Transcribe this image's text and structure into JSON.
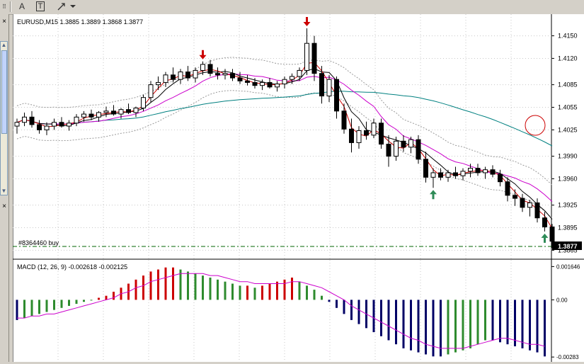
{
  "toolbar": {
    "buttons": [
      {
        "name": "text-tool-button",
        "label": "A"
      },
      {
        "name": "text-label-tool-button",
        "label": "T"
      },
      {
        "name": "arrows-tool-button",
        "label": "arrows-icon"
      }
    ]
  },
  "chart": {
    "symbol_line": "EURUSD,M15  1.3885 1.3889 1.3868 1.3877",
    "order_label": "#8364460 buy",
    "current_price": "1.3877",
    "price_ticks": [
      "1.4150",
      "1.4120",
      "1.4085",
      "1.4055",
      "1.4025",
      "1.3990",
      "1.3960",
      "1.3925",
      "1.3895",
      "1.3865"
    ],
    "macd_label": "MACD (12, 26, 9)  -0.002618 -0.002125",
    "macd_ticks": [
      "0.001646",
      "0.00",
      "-0.00283"
    ],
    "colors": {
      "bull": "#ffffff",
      "bear": "#000000",
      "ma_fast": "#cc0000",
      "ma_mid": "#000000",
      "ma_slow": "#cc00cc",
      "ma_long": "#008080",
      "envelope": "#999999",
      "hist_up": "#cc0000",
      "hist_green": "#2e8b2e",
      "hist_navy": "#000066",
      "signal": "#cc00cc",
      "order_line": "#006600"
    }
  },
  "chart_data": {
    "type": "candlestick",
    "ylim": [
      1.3855,
      1.4175
    ],
    "candles": [
      [
        1.403,
        1.404,
        1.402,
        1.4035
      ],
      [
        1.4035,
        1.4048,
        1.403,
        1.4042
      ],
      [
        1.4042,
        1.405,
        1.4028,
        1.4032
      ],
      [
        1.4032,
        1.4038,
        1.402,
        1.4025
      ],
      [
        1.4025,
        1.4035,
        1.4018,
        1.403
      ],
      [
        1.403,
        1.404,
        1.4025,
        1.4035
      ],
      [
        1.4035,
        1.4042,
        1.4028,
        1.403
      ],
      [
        1.403,
        1.4038,
        1.4024,
        1.4034
      ],
      [
        1.4034,
        1.4046,
        1.403,
        1.4042
      ],
      [
        1.4042,
        1.405,
        1.4036,
        1.4046
      ],
      [
        1.4046,
        1.4052,
        1.4038,
        1.4042
      ],
      [
        1.4042,
        1.405,
        1.4036,
        1.4048
      ],
      [
        1.4048,
        1.4056,
        1.4042,
        1.405
      ],
      [
        1.405,
        1.4058,
        1.4044,
        1.4046
      ],
      [
        1.4046,
        1.4054,
        1.404,
        1.4052
      ],
      [
        1.4052,
        1.406,
        1.4046,
        1.4048
      ],
      [
        1.4048,
        1.4056,
        1.4042,
        1.4054
      ],
      [
        1.4054,
        1.4072,
        1.405,
        1.4068
      ],
      [
        1.4068,
        1.409,
        1.4062,
        1.4085
      ],
      [
        1.4085,
        1.4096,
        1.4078,
        1.4088
      ],
      [
        1.4088,
        1.4102,
        1.4082,
        1.4098
      ],
      [
        1.4098,
        1.4108,
        1.4088,
        1.4092
      ],
      [
        1.4092,
        1.4106,
        1.4086,
        1.4102
      ],
      [
        1.4102,
        1.411,
        1.409,
        1.4094
      ],
      [
        1.4094,
        1.4108,
        1.4088,
        1.4104
      ],
      [
        1.4104,
        1.4116,
        1.4098,
        1.4112
      ],
      [
        1.4112,
        1.4118,
        1.4096,
        1.41
      ],
      [
        1.41,
        1.4108,
        1.4092,
        1.4098
      ],
      [
        1.4098,
        1.4106,
        1.4092,
        1.41
      ],
      [
        1.41,
        1.4106,
        1.409,
        1.4094
      ],
      [
        1.4094,
        1.4102,
        1.4086,
        1.409
      ],
      [
        1.409,
        1.4098,
        1.4084,
        1.4088
      ],
      [
        1.4088,
        1.4094,
        1.408,
        1.4084
      ],
      [
        1.4084,
        1.4092,
        1.4078,
        1.4088
      ],
      [
        1.4088,
        1.4094,
        1.408,
        1.4082
      ],
      [
        1.4082,
        1.409,
        1.4076,
        1.4086
      ],
      [
        1.4086,
        1.4096,
        1.408,
        1.4092
      ],
      [
        1.4092,
        1.41,
        1.4086,
        1.4096
      ],
      [
        1.4096,
        1.4108,
        1.409,
        1.4104
      ],
      [
        1.4104,
        1.416,
        1.4098,
        1.414
      ],
      [
        1.414,
        1.415,
        1.409,
        1.41
      ],
      [
        1.41,
        1.411,
        1.406,
        1.407
      ],
      [
        1.407,
        1.4098,
        1.4062,
        1.4092
      ],
      [
        1.4092,
        1.4096,
        1.404,
        1.405
      ],
      [
        1.405,
        1.406,
        1.402,
        1.4026
      ],
      [
        1.4026,
        1.404,
        1.3995,
        1.4008
      ],
      [
        1.4008,
        1.403,
        1.4,
        1.4024
      ],
      [
        1.4024,
        1.4036,
        1.4012,
        1.4018
      ],
      [
        1.4018,
        1.404,
        1.4014,
        1.4034
      ],
      [
        1.4034,
        1.404,
        1.4,
        1.4006
      ],
      [
        1.4006,
        1.4018,
        1.3976,
        1.399
      ],
      [
        1.399,
        1.4016,
        1.3984,
        1.401
      ],
      [
        1.401,
        1.4018,
        1.3996,
        1.4002
      ],
      [
        1.4002,
        1.4016,
        1.3994,
        1.4012
      ],
      [
        1.4012,
        1.4018,
        1.398,
        1.3986
      ],
      [
        1.3986,
        1.3996,
        1.3955,
        1.3962
      ],
      [
        1.3962,
        1.3974,
        1.3948,
        1.3968
      ],
      [
        1.3968,
        1.3974,
        1.3958,
        1.3962
      ],
      [
        1.3962,
        1.3972,
        1.3956,
        1.3968
      ],
      [
        1.3968,
        1.3976,
        1.396,
        1.3964
      ],
      [
        1.3964,
        1.3974,
        1.3958,
        1.397
      ],
      [
        1.397,
        1.398,
        1.3962,
        1.3974
      ],
      [
        1.3974,
        1.398,
        1.3964,
        1.3968
      ],
      [
        1.3968,
        1.3976,
        1.396,
        1.3972
      ],
      [
        1.3972,
        1.3978,
        1.3962,
        1.3966
      ],
      [
        1.3966,
        1.3972,
        1.395,
        1.3956
      ],
      [
        1.3956,
        1.3962,
        1.393,
        1.3938
      ],
      [
        1.3938,
        1.3946,
        1.3924,
        1.3934
      ],
      [
        1.3934,
        1.394,
        1.3916,
        1.3922
      ],
      [
        1.3922,
        1.3932,
        1.391,
        1.3928
      ],
      [
        1.3928,
        1.3934,
        1.3902,
        1.3908
      ],
      [
        1.3908,
        1.3916,
        1.389,
        1.3896
      ],
      [
        1.3896,
        1.39,
        1.3868,
        1.3877
      ]
    ],
    "macd_ylim": [
      -0.003,
      0.0018
    ],
    "macd_hist": [
      -0.001,
      -0.0009,
      -0.0008,
      -0.0007,
      -0.0006,
      -0.0005,
      -0.0004,
      -0.0003,
      -0.0002,
      -0.0001,
      0.0,
      0.0001,
      0.0002,
      0.0004,
      0.0006,
      0.0008,
      0.001,
      0.0012,
      0.0014,
      0.0015,
      0.0016,
      0.0016,
      0.0015,
      0.0014,
      0.0013,
      0.0012,
      0.0011,
      0.001,
      0.0009,
      0.0008,
      0.0007,
      0.0007,
      0.0006,
      0.0007,
      0.0008,
      0.0009,
      0.001,
      0.0011,
      0.0009,
      0.0007,
      0.0005,
      0.0002,
      -0.0001,
      -0.0004,
      -0.0007,
      -0.001,
      -0.0012,
      -0.0014,
      -0.0016,
      -0.0018,
      -0.002,
      -0.0022,
      -0.0024,
      -0.0025,
      -0.0026,
      -0.0027,
      -0.0028,
      -0.0028,
      -0.0027,
      -0.0026,
      -0.0025,
      -0.0024,
      -0.0022,
      -0.002,
      -0.002,
      -0.0021,
      -0.0022,
      -0.0023,
      -0.0024,
      -0.0025,
      -0.0026,
      -0.0028
    ],
    "macd_signal": [
      -0.0009,
      -0.0009,
      -0.0008,
      -0.0008,
      -0.0007,
      -0.0007,
      -0.0006,
      -0.0005,
      -0.0004,
      -0.0003,
      -0.0002,
      -0.0001,
      0.0,
      0.0001,
      0.0003,
      0.0004,
      0.0006,
      0.0007,
      0.0009,
      0.001,
      0.0011,
      0.0012,
      0.0013,
      0.0013,
      0.0013,
      0.0013,
      0.0012,
      0.0012,
      0.0011,
      0.001,
      0.0009,
      0.0009,
      0.0008,
      0.0008,
      0.0008,
      0.0008,
      0.0008,
      0.0009,
      0.0009,
      0.0008,
      0.0007,
      0.0006,
      0.0004,
      0.0002,
      0.0,
      -0.0003,
      -0.0005,
      -0.0007,
      -0.0009,
      -0.0011,
      -0.0013,
      -0.0015,
      -0.0017,
      -0.0019,
      -0.002,
      -0.0022,
      -0.0023,
      -0.0024,
      -0.0024,
      -0.0024,
      -0.0024,
      -0.0023,
      -0.0022,
      -0.0021,
      -0.002,
      -0.0019,
      -0.0019,
      -0.002,
      -0.0021,
      -0.0022,
      -0.0022,
      -0.0023
    ],
    "arrows": [
      {
        "index": 25,
        "dir": "down"
      },
      {
        "index": 39,
        "dir": "down"
      },
      {
        "index": 56,
        "dir": "up"
      },
      {
        "index": 71,
        "dir": "up"
      }
    ]
  }
}
